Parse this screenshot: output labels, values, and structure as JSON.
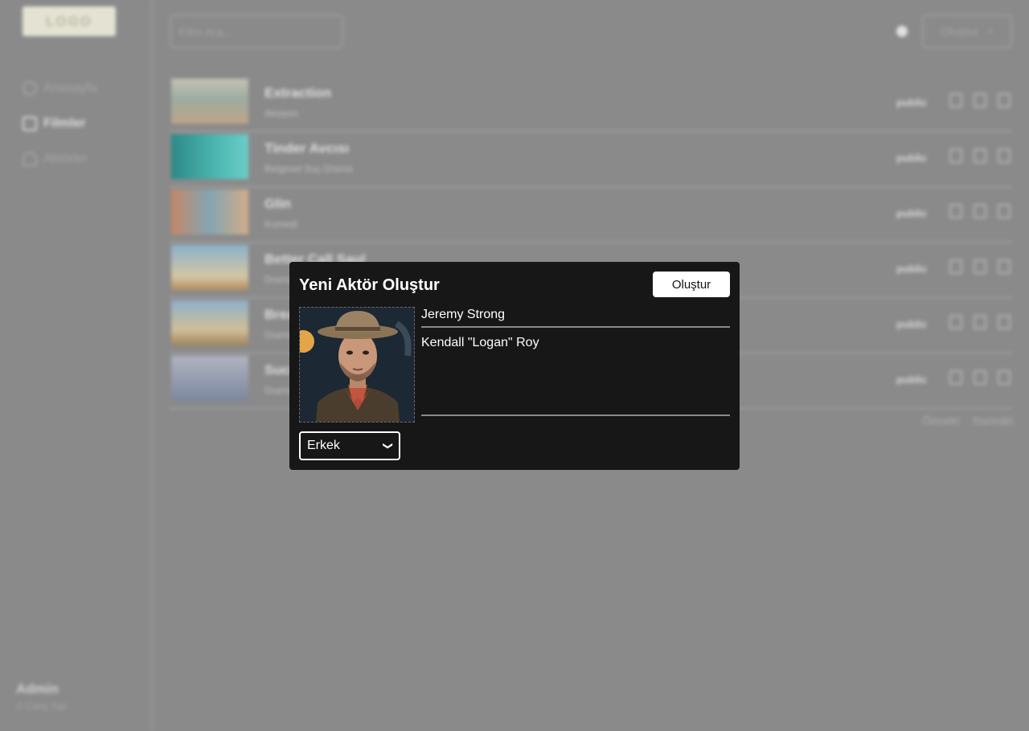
{
  "background": {
    "logo_text": "LOGO",
    "sidebar": {
      "items": [
        {
          "label": "Anasayfa",
          "icon": "home-icon",
          "active": false
        },
        {
          "label": "Filmler",
          "icon": "film-icon",
          "active": true
        },
        {
          "label": "Aktörler",
          "icon": "user-icon",
          "active": false
        }
      ],
      "user_name": "Admin",
      "user_sub": "© Çıkış Yap"
    },
    "toolbar": {
      "search_placeholder": "Film Ara...",
      "create_label": "Oluştur",
      "create_icon": "plus-icon"
    },
    "films": [
      {
        "title": "Extraction",
        "subtitle": "Aksiyon",
        "status": "public"
      },
      {
        "title": "Tinder Avcısı",
        "subtitle": "Belgesel Suç Drama",
        "status": "public"
      },
      {
        "title": "Glin",
        "subtitle": "Komedi",
        "status": "public"
      },
      {
        "title": "Better Call Saul",
        "subtitle": "Drama",
        "status": "public"
      },
      {
        "title": "Breaking Bad",
        "subtitle": "Drama",
        "status": "public"
      },
      {
        "title": "Succession",
        "subtitle": "Drama",
        "status": "public"
      }
    ],
    "pagination": {
      "prev": "Önceki",
      "next": "Sonraki"
    }
  },
  "modal": {
    "title": "Yeni Aktör Oluştur",
    "submit_label": "Oluştur",
    "name_value": "Jeremy Strong",
    "role_value": "Kendall \"Logan\" Roy",
    "gender": {
      "selected": "Erkek",
      "options": [
        "Erkek"
      ]
    },
    "photo_icon": "actor-photo"
  },
  "colors": {
    "modal_bg": "#171717",
    "overlay_bg": "#8d8d8d",
    "button_bg": "#ffffff"
  }
}
